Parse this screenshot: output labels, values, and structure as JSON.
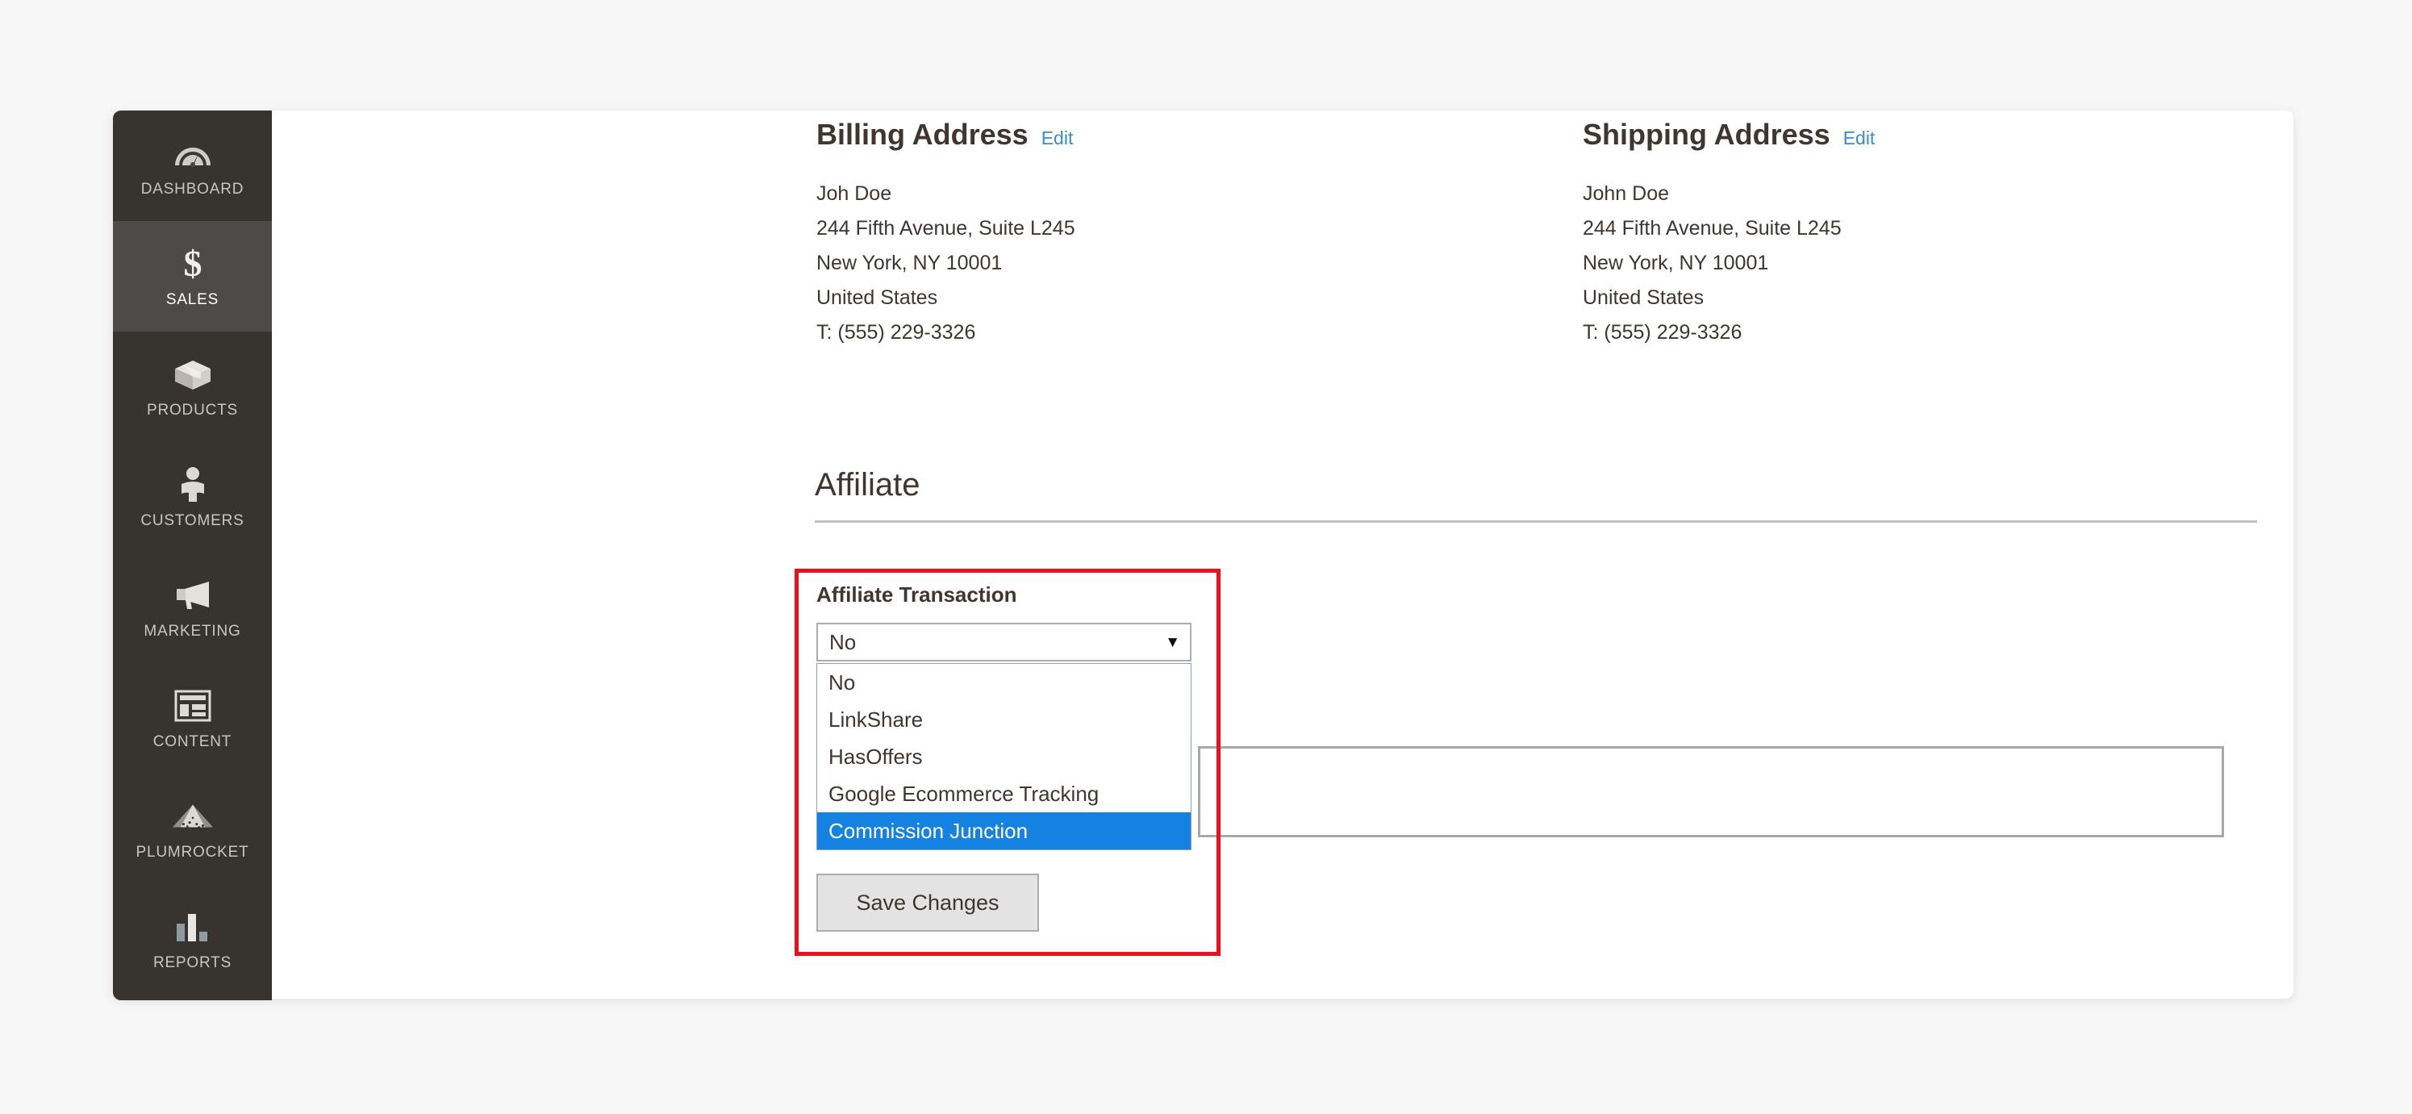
{
  "sidebar": {
    "items": [
      {
        "label": "DASHBOARD",
        "icon": "gauge-icon",
        "active": false
      },
      {
        "label": "SALES",
        "icon": "dollar-icon",
        "active": true
      },
      {
        "label": "PRODUCTS",
        "icon": "box-icon",
        "active": false
      },
      {
        "label": "CUSTOMERS",
        "icon": "person-icon",
        "active": false
      },
      {
        "label": "MARKETING",
        "icon": "megaphone-icon",
        "active": false
      },
      {
        "label": "CONTENT",
        "icon": "layout-icon",
        "active": false
      },
      {
        "label": "PLUMROCKET",
        "icon": "pyramid-icon",
        "active": false
      },
      {
        "label": "REPORTS",
        "icon": "bar-chart-icon",
        "active": false
      }
    ]
  },
  "billing_address": {
    "title": "Billing Address",
    "edit_label": "Edit",
    "lines": [
      "Joh Doe",
      "244 Fifth Avenue, Suite L245",
      "New York, NY 10001",
      "United States",
      "T: (555) 229-3326"
    ]
  },
  "shipping_address": {
    "title": "Shipping Address",
    "edit_label": "Edit",
    "lines": [
      "John Doe",
      "244 Fifth Avenue, Suite L245",
      "New York, NY 10001",
      "United States",
      "T: (555) 229-3326"
    ]
  },
  "affiliate": {
    "section_heading": "Affiliate",
    "field_label": "Affiliate Transaction",
    "selected_value": "No",
    "caret_icon": "chevron-down-icon",
    "options": [
      "No",
      "LinkShare",
      "HasOffers",
      "Google Ecommerce Tracking",
      "Commission Junction"
    ],
    "highlighted_option": "Commission Junction",
    "save_label": "Save Changes",
    "comment_value": "",
    "comment_placeholder": ""
  },
  "colors": {
    "sidebar_bg": "#37332f",
    "sidebar_active_bg": "#4e4a47",
    "highlight_box_border": "#ef0e1e",
    "option_selected_bg": "#1581e0",
    "link_blue": "#3a8bd1",
    "page_bg": "#f7f7f7"
  }
}
